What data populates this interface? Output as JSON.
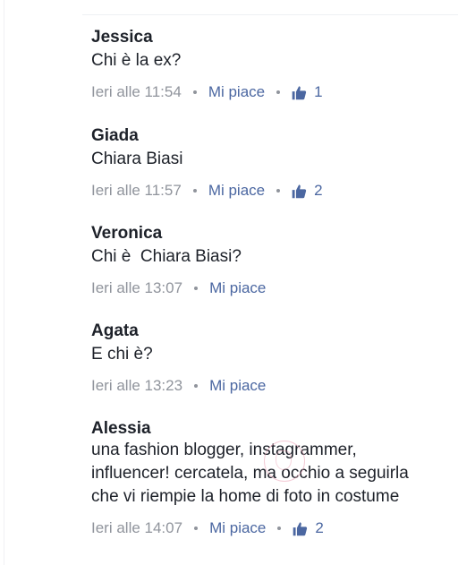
{
  "comments": [
    {
      "author": "Jessica",
      "text": "Chi è la ex?",
      "time": "Ieri alle 11:54",
      "like_label": "Mi piace",
      "likes": "1"
    },
    {
      "author": "Giada",
      "text": "Chiara Biasi",
      "time": "Ieri alle 11:57",
      "like_label": "Mi piace",
      "likes": "2"
    },
    {
      "author": "Veronica",
      "text": "Chi è  Chiara Biasi?",
      "time": "Ieri alle 13:07",
      "like_label": "Mi piace"
    },
    {
      "author": "Agata",
      "text": "E chi è?",
      "time": "Ieri alle 13:23",
      "like_label": "Mi piace"
    },
    {
      "author": "Alessia",
      "text_lines": [
        "una fashion blogger, instagrammer,",
        "influencer! cercatela, ma occhio a seguirla",
        "che vi riempie la home di foto in costume"
      ],
      "time": "Ieri alle 14:07",
      "like_label": "Mi piace",
      "likes": "2"
    }
  ],
  "colors": {
    "text": "#1d2129",
    "meta": "#90949c",
    "link": "#4b67a1"
  },
  "icons": {
    "like": "thumbs-up-icon"
  }
}
